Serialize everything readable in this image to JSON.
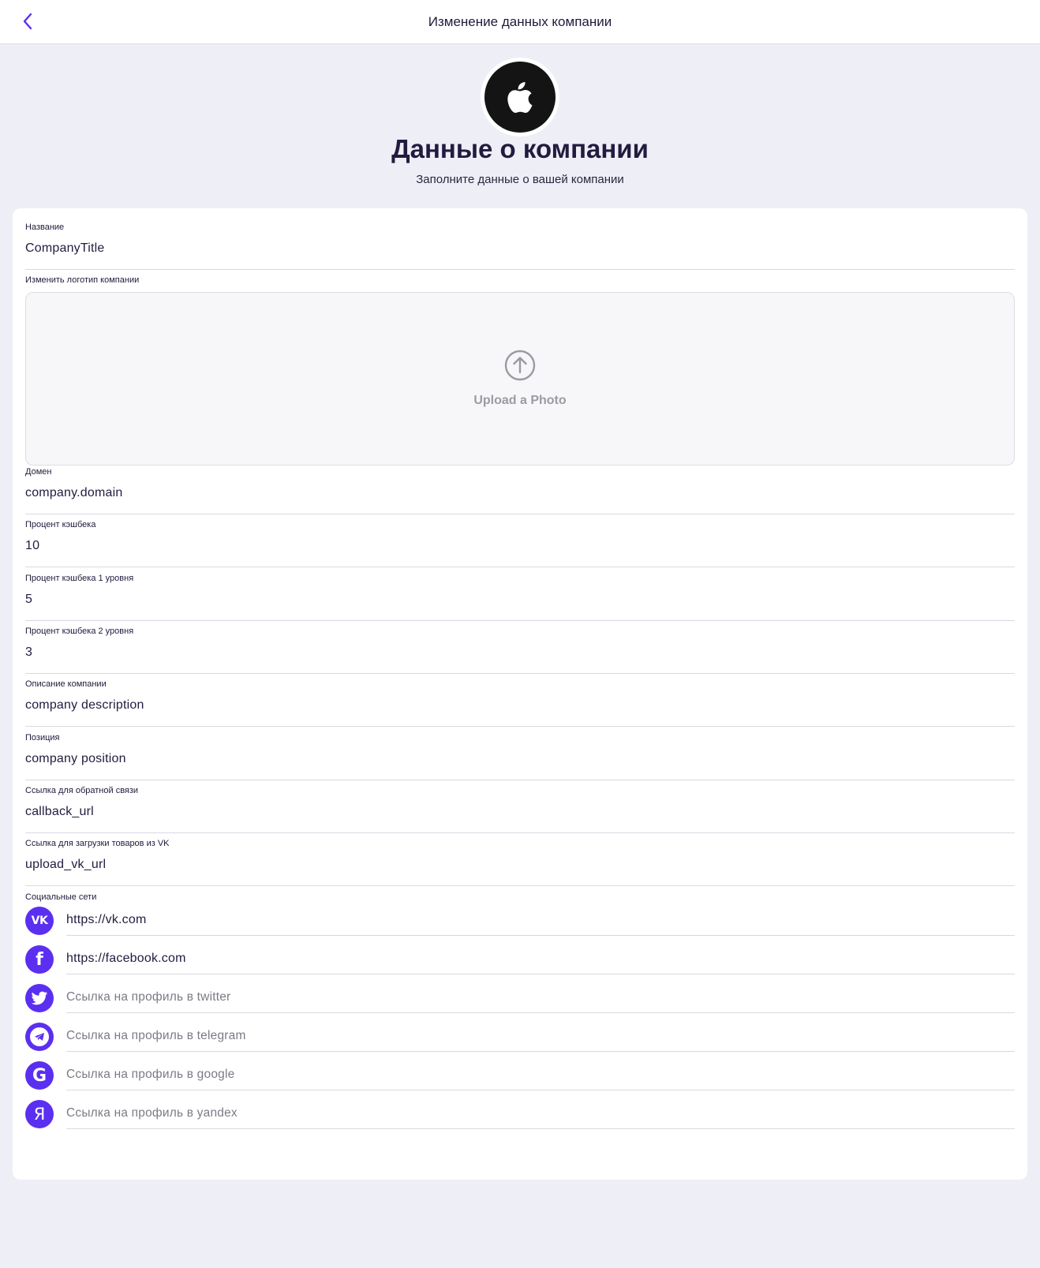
{
  "header": {
    "title": "Изменение данных компании",
    "back_icon": "chevron-left-icon"
  },
  "company": {
    "logo_icon": "apple-logo-icon",
    "heading": "Данные о компании",
    "subheading": "Заполните данные о вашей компании"
  },
  "colors": {
    "accent": "#5b2ff0",
    "background": "#eeeef6",
    "card": "#ffffff",
    "text": "#231b3f"
  },
  "form": {
    "name": {
      "label": "Название",
      "value": "CompanyTitle"
    },
    "logo": {
      "label": "Изменить логотип компании",
      "upload_text": "Upload a Photo",
      "icon": "upload-arrow-icon"
    },
    "domain": {
      "label": "Домен",
      "value": "company.domain"
    },
    "cashback": {
      "label": "Процент кэшбека",
      "value": "10"
    },
    "cashback_l1": {
      "label": "Процент кэшбека 1 уровня",
      "value": "5"
    },
    "cashback_l2": {
      "label": "Процент кэшбека 2 уровня",
      "value": "3"
    },
    "description": {
      "label": "Описание компании",
      "value": "company description"
    },
    "position": {
      "label": "Позиция",
      "value": "company position"
    },
    "callback": {
      "label": "Ссылка для обратной связи",
      "value": "callback_url"
    },
    "upload_vk": {
      "label": "Ссылка для загрузки товаров из VK",
      "value": "upload_vk_url"
    }
  },
  "social": {
    "label": "Социальные сети",
    "items": [
      {
        "network": "vk",
        "icon": "vk-icon",
        "value": "https://vk.com",
        "placeholder": ""
      },
      {
        "network": "facebook",
        "icon": "facebook-icon",
        "value": "https://facebook.com",
        "placeholder": ""
      },
      {
        "network": "twitter",
        "icon": "twitter-icon",
        "value": "",
        "placeholder": "Ссылка на профиль в twitter"
      },
      {
        "network": "telegram",
        "icon": "telegram-icon",
        "value": "",
        "placeholder": "Ссылка на профиль в telegram"
      },
      {
        "network": "google",
        "icon": "google-icon",
        "value": "",
        "placeholder": "Ссылка на профиль в google"
      },
      {
        "network": "yandex",
        "icon": "yandex-icon",
        "value": "",
        "placeholder": "Ссылка на профиль в yandex"
      }
    ]
  }
}
